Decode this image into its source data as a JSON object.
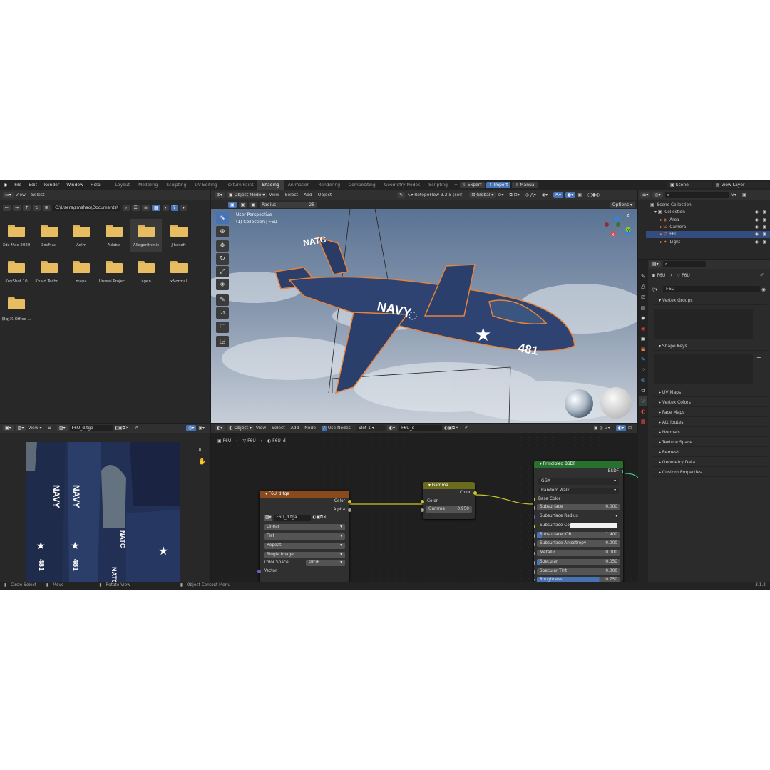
{
  "app": {
    "menus": [
      "File",
      "Edit",
      "Render",
      "Window",
      "Help"
    ],
    "workspaces": [
      "Layout",
      "Modeling",
      "Sculpting",
      "UV Editing",
      "Texture Paint",
      "Shading",
      "Animation",
      "Rendering",
      "Compositing",
      "Geometry Nodes",
      "Scripting"
    ],
    "active_workspace": "Shading",
    "add_tab": "+",
    "export_label": "Export",
    "import_label": "Import",
    "manual_label": "Manual",
    "scene_label": "Scene",
    "view_layer_label": "View Layer",
    "version": "3.1.2"
  },
  "file_browser": {
    "menu": [
      "View",
      "Select"
    ],
    "path": "C:\\Users\\zmshao\\Documents\\",
    "folders": [
      "3ds Max 2020",
      "3dsMax",
      "Adlm",
      "Adobe",
      "Allegorithmic",
      "Jihosoft",
      "KeyShot 10",
      "Knald Techn...",
      "maya",
      "Unreal Projec...",
      "xgen",
      "xNormal",
      "自定义 Office ..."
    ],
    "selected_folder": "Allegorithmic"
  },
  "viewport": {
    "mode": "Object Mode",
    "menu": [
      "View",
      "Select",
      "Add",
      "Object"
    ],
    "addon": "RetopoFlow 3.2.5 (self)",
    "orientation": "Global",
    "radius_label": "Radius",
    "radius_value": "25",
    "options_label": "Options",
    "perspective": "User Perspective",
    "collection": "(1) Collection | F6U",
    "axis_z": "Z",
    "axis_y": "Y",
    "axis_x": "X",
    "plane_text": {
      "navy": "NAVY",
      "natc": "NATC",
      "number": "481"
    }
  },
  "image_editor": {
    "view_label": "View",
    "image_name": "F6U_d.tga",
    "texture_text": {
      "navy1": "NAVY",
      "navy2": "NAVY",
      "natc1": "NATC",
      "natc2": "NATC",
      "num1": "481",
      "num2": "481"
    }
  },
  "node_editor": {
    "object_label": "Object",
    "menu": [
      "View",
      "Select",
      "Add",
      "Node"
    ],
    "use_nodes_label": "Use Nodes",
    "slot": "Slot 1",
    "material": "F6U_d",
    "breadcrumb": [
      "F6U",
      "F6U",
      "F6U_d"
    ],
    "image_node": {
      "title": "F6U_d.tga",
      "outputs": [
        "Color",
        "Alpha"
      ],
      "image": "F6U_d.tga",
      "interpolation": "Linear",
      "projection": "Flat",
      "extension": "Repeat",
      "source": "Single Image",
      "color_space_label": "Color Space",
      "color_space": "sRGB",
      "vector_label": "Vector"
    },
    "gamma_node": {
      "title": "Gamma",
      "output": "Color",
      "input": "Color",
      "gamma_label": "Gamma",
      "gamma_value": "0.950"
    },
    "bsdf_node": {
      "title": "Principled BSDF",
      "output": "BSDF",
      "distribution": "GGX",
      "subsurface_method": "Random Walk",
      "base_color_label": "Base Color",
      "props": [
        {
          "label": "Subsurface",
          "value": "0.000"
        },
        {
          "label": "Subsurface Radius",
          "value": ""
        },
        {
          "label": "Subsurface Col...",
          "value": ""
        },
        {
          "label": "Subsurface IOR",
          "value": "1.400"
        },
        {
          "label": "Subsurface Anisotropy",
          "value": "0.000"
        },
        {
          "label": "Metallic",
          "value": "0.000"
        },
        {
          "label": "Specular",
          "value": "0.050"
        },
        {
          "label": "Specular Tint",
          "value": "0.000"
        },
        {
          "label": "Roughness",
          "value": "0.750"
        }
      ]
    }
  },
  "outliner": {
    "items": [
      {
        "label": "Scene Collection"
      },
      {
        "label": "Collection"
      },
      {
        "label": "Area"
      },
      {
        "label": "Camera"
      },
      {
        "label": "F6U"
      },
      {
        "label": "Light"
      }
    ],
    "selected": "F6U"
  },
  "properties": {
    "breadcrumb": [
      "F6U",
      "F6U"
    ],
    "mesh_name": "F6U",
    "sections": [
      "Vertex Groups",
      "Shape Keys",
      "UV Maps",
      "Vertex Colors",
      "Face Maps",
      "Attributes",
      "Normals",
      "Texture Space",
      "Remesh",
      "Geometry Data",
      "Custom Properties"
    ]
  },
  "status_bar": {
    "items": [
      "Circle Select",
      "Move",
      "Rotate View",
      "Object Context Menu"
    ]
  },
  "colors": {
    "accent": "#4772b3",
    "image_node_header": "#8a4a1e",
    "gamma_node_header": "#6b6b1e",
    "bsdf_node_header": "#27712f",
    "folder": "#e8bd61",
    "selection_outline": "#e8833a"
  }
}
